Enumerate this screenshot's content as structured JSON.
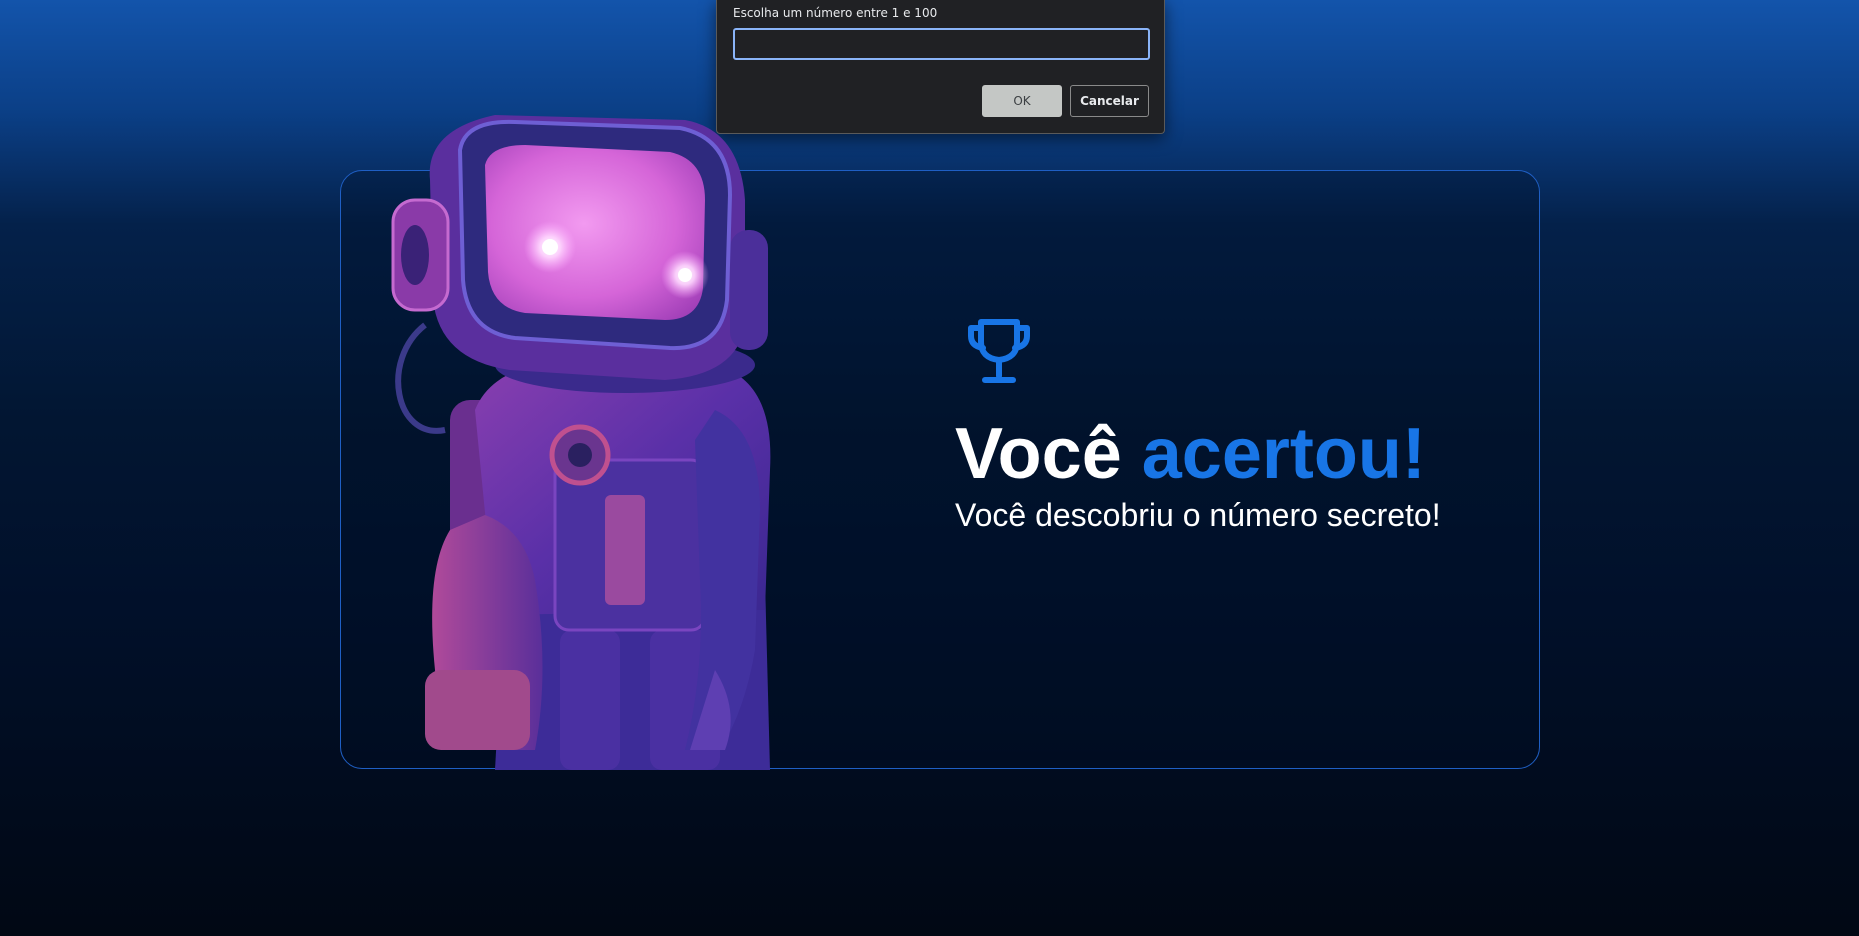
{
  "prompt": {
    "message": "Escolha um número entre 1 e 100",
    "input_value": "",
    "ok_label": "OK",
    "cancel_label": "Cancelar"
  },
  "result": {
    "icon": "trophy-icon",
    "title_prefix": "Você",
    "title_highlight": "acertou!",
    "subtitle": "Você descobriu o número secreto!"
  },
  "colors": {
    "accent": "#1875e6",
    "card_border": "#1f5fc4",
    "dialog_bg": "#202124",
    "input_focus": "#8ab4f8"
  }
}
